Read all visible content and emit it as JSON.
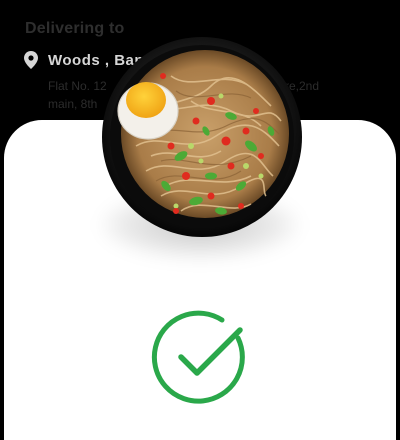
{
  "header": {
    "title": "Delivering to",
    "location_name": "Woods , Ban",
    "address_line_1": "Flat No. 12",
    "address_line_2": "main, 8th",
    "address_tail_1": "re,2nd"
  },
  "colors": {
    "header_bg": "#000000",
    "card_bg": "#ffffff",
    "success_green": "#2aa84a"
  },
  "icons": {
    "location": "location-pin-icon",
    "success": "check-circle-icon"
  },
  "dish": {
    "image": "noodle-bowl-with-egg"
  }
}
